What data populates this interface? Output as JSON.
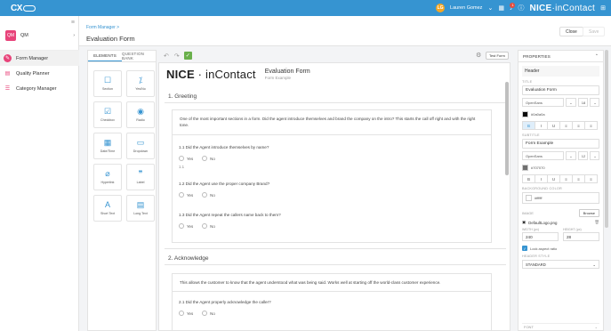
{
  "topbar": {
    "logo": "CX",
    "user_initials": "LG",
    "user_name": "Lauren Gomez",
    "notification_count": "1",
    "brand_bold": "NICE",
    "brand_light": "inContact",
    "brand_sep": "·"
  },
  "sidebar": {
    "module_icon": "QM",
    "module_label": "QM",
    "items": [
      {
        "label": "Form Manager",
        "icon": "form-icon"
      },
      {
        "label": "Quality Planner",
        "icon": "planner-icon"
      },
      {
        "label": "Category Manager",
        "icon": "category-icon"
      }
    ]
  },
  "header": {
    "breadcrumb": "Form Manager  >",
    "title": "Evaluation Form",
    "close_label": "Close",
    "save_label": "Save"
  },
  "elements": {
    "tabs": [
      "ELEMENTS",
      "QUESTION BANK"
    ],
    "items": [
      {
        "label": "Section",
        "glyph": "☐"
      },
      {
        "label": "Yes/No",
        "glyph": "⁒"
      },
      {
        "label": "Checkbox",
        "glyph": "☑"
      },
      {
        "label": "Radio",
        "glyph": "◉"
      },
      {
        "label": "Date/Time",
        "glyph": "▦"
      },
      {
        "label": "Dropdown",
        "glyph": "▭"
      },
      {
        "label": "Hyperlink",
        "glyph": "⌀"
      },
      {
        "label": "Label",
        "glyph": "❞"
      },
      {
        "label": "Short Text",
        "glyph": "A"
      },
      {
        "label": "Long Text",
        "glyph": "▤"
      }
    ]
  },
  "canvas": {
    "undo": "↶",
    "redo": "↷",
    "save_glyph": "✓",
    "gear": "⚙",
    "test_label": "Test Form",
    "logo_bold": "NICE",
    "logo_sep": " · ",
    "logo_light": "inContact",
    "form_title": "Evaluation Form",
    "form_subtitle": "Form Example",
    "sections": [
      {
        "heading": "1. Greeting",
        "intro": "One of the most important sections in a form. Did the agent introduce themselves and brand the company on the intro? This starts the call off right and with the right tone.",
        "questions": [
          {
            "text": "1.1  Did the Agent introduce themselves by name?",
            "options": [
              "Yes",
              "No"
            ],
            "note": "1.1"
          },
          {
            "text": "1.2  Did the Agent use the proper company Brand?",
            "options": [
              "Yes",
              "No"
            ]
          },
          {
            "text": "1.3  Did the Agent repeat the callers name back to them?",
            "options": [
              "Yes",
              "No"
            ]
          }
        ]
      },
      {
        "heading": "2. Acknowledge",
        "intro": "This allows the customer to know that the agent understood what was being said. Works well at starting off the world-class customer experience.",
        "questions": [
          {
            "text": "2.1  Did the Agent properly acknowledge the caller?",
            "options": [
              "Yes",
              "No"
            ]
          }
        ]
      }
    ]
  },
  "properties": {
    "panel_title": "PROPERTIES",
    "collapse": "⌃",
    "header_section": "Header",
    "title_label": "TITLE",
    "title_value": "Evaluation Form",
    "font_family": "OpenSans",
    "font_size": "18",
    "title_color": "#0a0a0a",
    "subtitle_label": "SUBTITLE",
    "subtitle_value": "Form Example",
    "sub_font_family": "OpenSans",
    "sub_font_size": "12",
    "subtitle_color": "#707070",
    "fmt": [
      "B",
      "I",
      "U",
      "≡",
      "≡",
      "≡"
    ],
    "bg_label": "BACKGROUND COLOR",
    "bg_value": "#ffffff",
    "image_label": "IMAGE",
    "browse_label": "Browse",
    "file_name": "DefaultLogo.png",
    "width_label": "WIDTH (px)",
    "width_value": "240",
    "height_label": "HEIGHT (px)",
    "height_value": "28",
    "aspect_label": "Lock aspect ratio",
    "header_style_label": "HEADER STYLE",
    "header_style_value": "STANDARD",
    "font_section": "FONT",
    "colors": {
      "accent": "#3694d1",
      "pink": "#e8437a",
      "save": "#6ab04c"
    }
  }
}
